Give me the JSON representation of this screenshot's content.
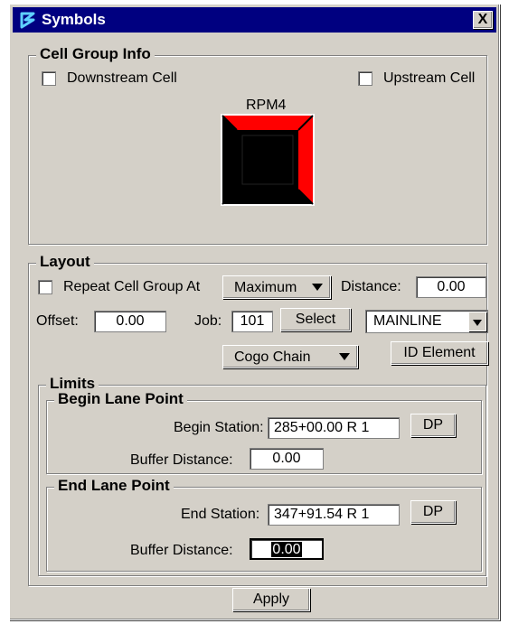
{
  "window": {
    "title": "Symbols",
    "title_icon": "app-logo-icon",
    "close_label": "X"
  },
  "cell_group": {
    "label": "Cell Group Info",
    "downstream_label": "Downstream Cell",
    "downstream_checked": false,
    "upstream_label": "Upstream Cell",
    "upstream_checked": false,
    "cell_name": "RPM4",
    "cell_colors": {
      "outer": "#ff0000",
      "inner": "#000000",
      "bevel": "#000000"
    }
  },
  "layout": {
    "label": "Layout",
    "repeat_label": "Repeat Cell Group At",
    "repeat_checked": false,
    "repeat_mode": "Maximum",
    "distance_label": "Distance:",
    "distance_value": "0.00",
    "offset_label": "Offset:",
    "offset_value": "0.00",
    "job_label": "Job:",
    "job_value": "101",
    "select_label": "Select",
    "chain_value": "MAINLINE",
    "cogo_value": "Cogo Chain",
    "id_element_label": "ID Element"
  },
  "limits": {
    "label": "Limits",
    "begin": {
      "label": "Begin Lane Point",
      "station_label": "Begin Station:",
      "station_value": "285+00.00 R 1",
      "dp_label": "DP",
      "buffer_label": "Buffer Distance:",
      "buffer_value": "0.00"
    },
    "end": {
      "label": "End Lane Point",
      "station_label": "End Station:",
      "station_value": "347+91.54 R 1",
      "dp_label": "DP",
      "buffer_label": "Buffer Distance:",
      "buffer_value": "0.00"
    }
  },
  "apply_label": "Apply"
}
